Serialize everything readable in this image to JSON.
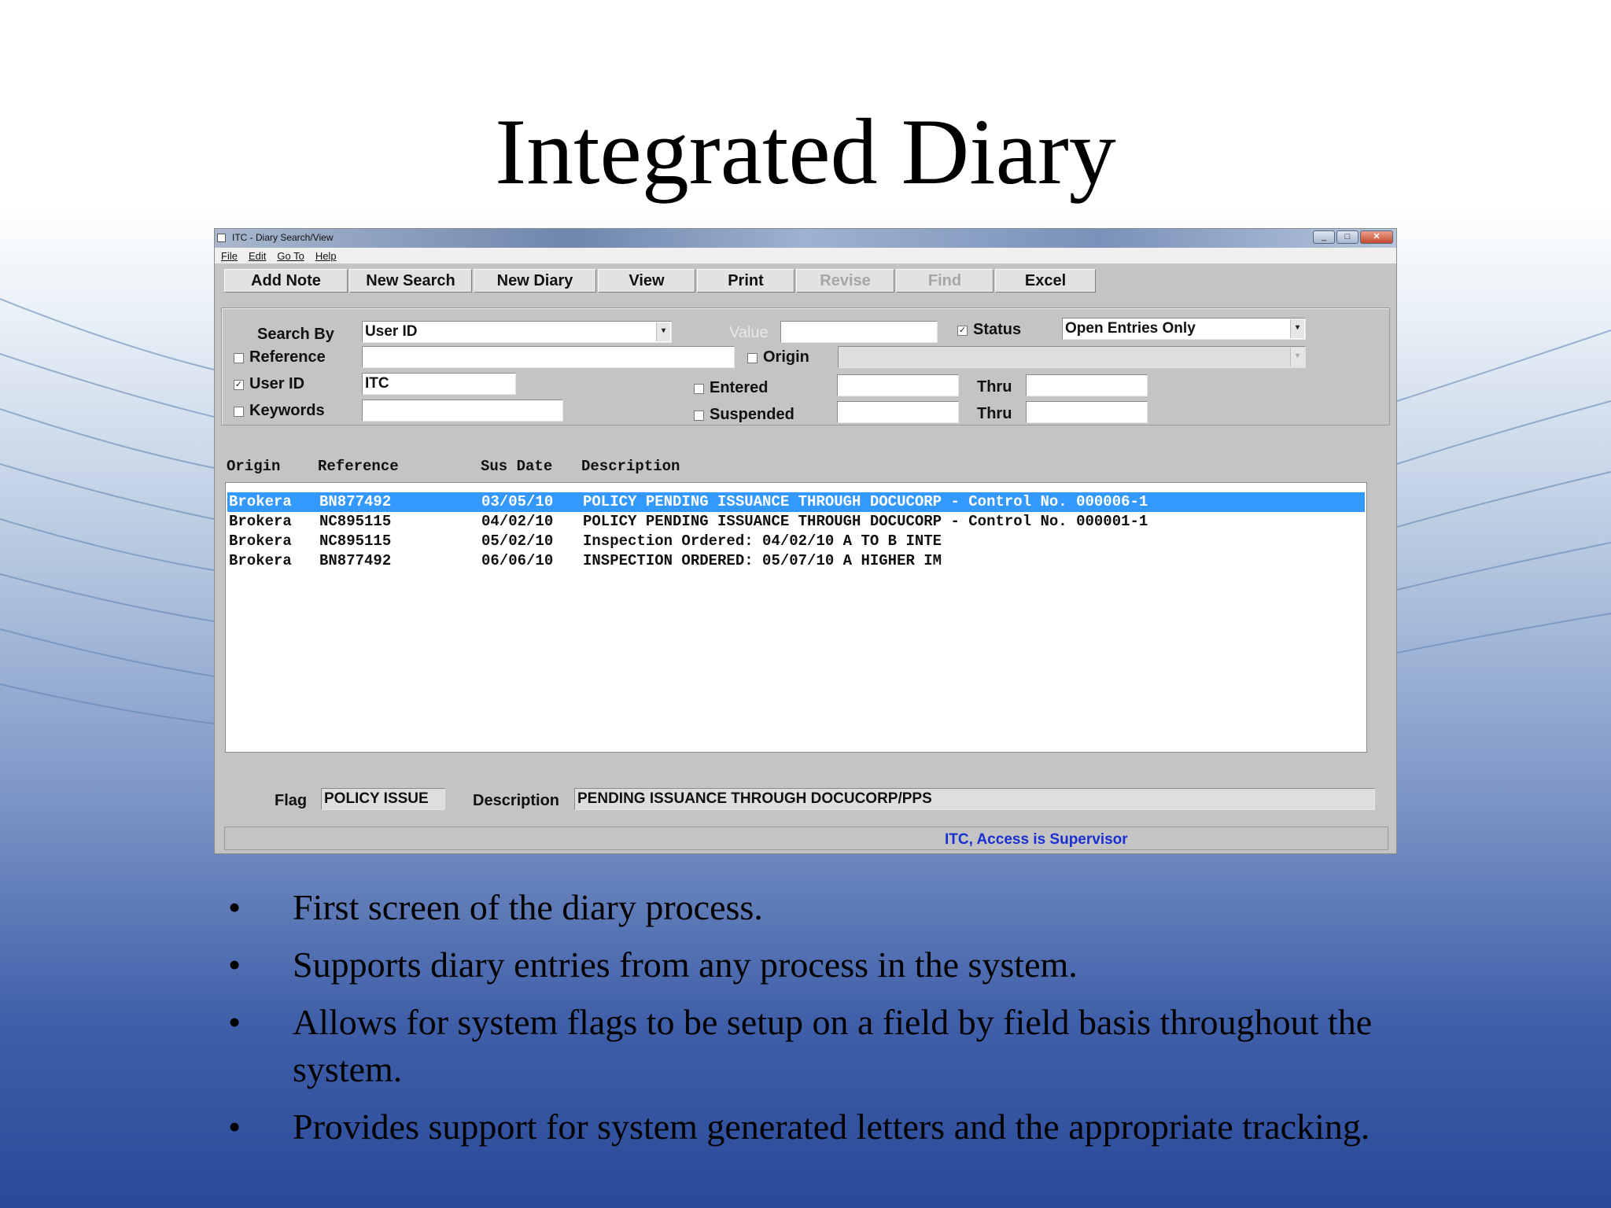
{
  "slide": {
    "title": "Integrated Diary",
    "bullets": [
      "First screen of the diary process.",
      "Supports diary entries from any process in the system.",
      "Allows for system flags to be setup on a field by field basis throughout the system.",
      "Provides support for system generated letters and the appropriate tracking."
    ]
  },
  "window": {
    "title": "ITC - Diary Search/View",
    "menu": [
      "File",
      "Edit",
      "Go To",
      "Help"
    ],
    "toolbar": {
      "add_note": "Add Note",
      "new_search": "New Search",
      "new_diary": "New Diary",
      "view": "View",
      "print": "Print",
      "revise": "Revise",
      "find": "Find",
      "excel": "Excel"
    }
  },
  "search": {
    "search_by_label": "Search By",
    "search_by_value": "User ID",
    "value_label": "Value",
    "value_value": "",
    "status_label": "Status",
    "status_checked": true,
    "status_value": "Open Entries Only",
    "reference_label": "Reference",
    "reference_checked": false,
    "reference_value": "",
    "origin_label": "Origin",
    "origin_checked": false,
    "origin_value": "",
    "user_id_label": "User ID",
    "user_id_checked": true,
    "user_id_value": "ITC",
    "entered_label": "Entered",
    "entered_checked": false,
    "entered_from": "",
    "entered_thru_label": "Thru",
    "entered_thru": "",
    "keywords_label": "Keywords",
    "keywords_checked": false,
    "keywords_value": "",
    "suspended_label": "Suspended",
    "suspended_checked": false,
    "suspended_from": "",
    "suspended_thru_label": "Thru",
    "suspended_thru": ""
  },
  "results": {
    "columns": [
      "Origin",
      "Reference",
      "Sus Date",
      "Description"
    ],
    "rows": [
      {
        "origin": "Brokera",
        "reference": "BN877492",
        "sus_date": "03/05/10",
        "description": "POLICY PENDING ISSUANCE THROUGH DOCUCORP - Control No. 000006-1",
        "selected": true
      },
      {
        "origin": "Brokera",
        "reference": "NC895115",
        "sus_date": "04/02/10",
        "description": "POLICY PENDING ISSUANCE THROUGH DOCUCORP - Control No. 000001-1",
        "selected": false
      },
      {
        "origin": "Brokera",
        "reference": "NC895115",
        "sus_date": "05/02/10",
        "description": "Inspection Ordered: 04/02/10 A TO B INTE",
        "selected": false
      },
      {
        "origin": "Brokera",
        "reference": "BN877492",
        "sus_date": "06/06/10",
        "description": "INSPECTION ORDERED: 05/07/10 A HIGHER IM",
        "selected": false
      }
    ]
  },
  "detail": {
    "flag_label": "Flag",
    "flag_value": "POLICY ISSUE",
    "description_label": "Description",
    "description_value": "PENDING ISSUANCE THROUGH DOCUCORP/PPS"
  },
  "status_bar": {
    "text": "ITC, Access is Supervisor"
  },
  "icons": {
    "dropdown": "chevron-down-icon",
    "checkbox_checked": "check-icon",
    "minimize": "minimize-icon",
    "maximize": "maximize-icon",
    "close": "close-icon"
  },
  "colors": {
    "selection": "#3399ff",
    "status_text": "#1a2fd0",
    "window_bg": "#c4c4c4"
  }
}
